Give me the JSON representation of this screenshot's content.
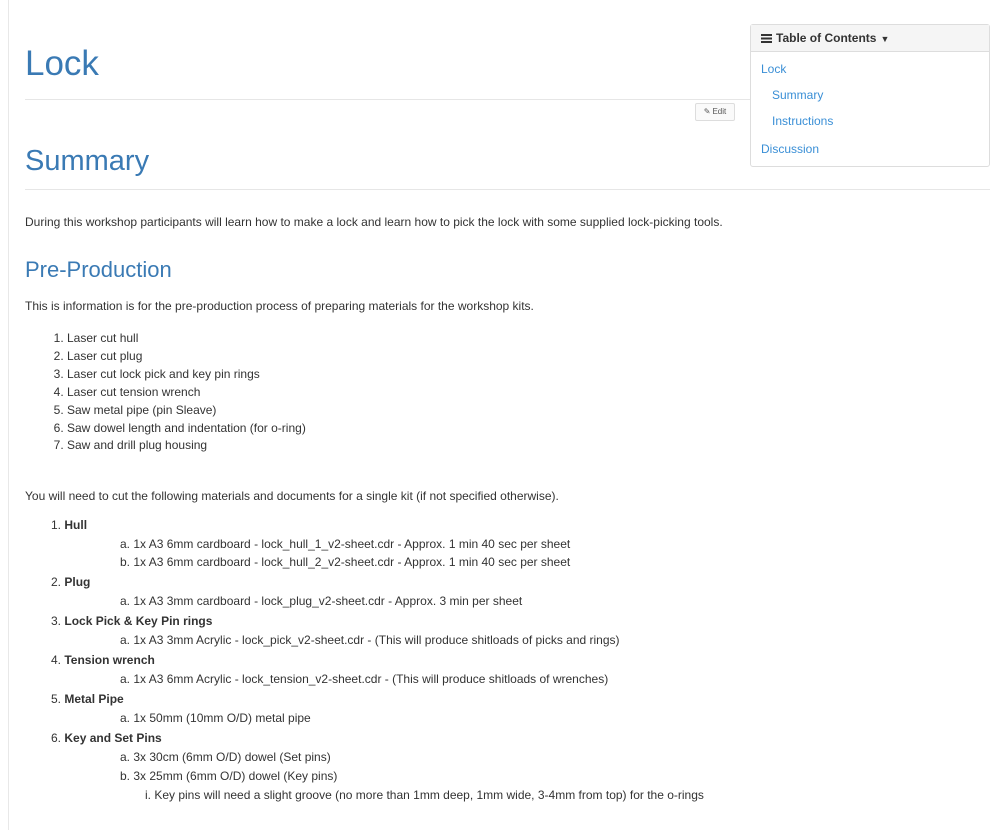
{
  "page": {
    "title": "Lock",
    "edit_label": "Edit",
    "summary_heading": "Summary",
    "summary_text": "During this workshop participants will learn how to make a lock and learn how to pick the lock with some supplied lock-picking tools.",
    "preproduction_heading": "Pre-Production",
    "preproduction_text": "This is information is for the pre-production process of preparing materials for the workshop kits.",
    "steps": [
      "Laser cut hull",
      "Laser cut plug",
      "Laser cut lock pick and key pin rings",
      "Laser cut tension wrench",
      "Saw metal pipe (pin Sleave)",
      "Saw dowel length and indentation (for o-ring)",
      "Saw and drill plug housing"
    ],
    "need_text": "You will need to cut the following materials and documents for a single kit (if not specified otherwise).",
    "materials": {
      "hull": {
        "num": "1.",
        "label": "Hull",
        "a": "a. 1x A3 6mm cardboard - lock_hull_1_v2-sheet.cdr - Approx. 1 min 40 sec per sheet",
        "b": "b. 1x A3 6mm cardboard - lock_hull_2_v2-sheet.cdr - Approx. 1 min 40 sec per sheet"
      },
      "plug": {
        "num": "2.",
        "label": "Plug",
        "a": "a. 1x A3 3mm cardboard - lock_plug_v2-sheet.cdr - Approx. 3 min per sheet"
      },
      "pick": {
        "num": "3.",
        "label": "Lock Pick & Key Pin rings",
        "a": "a. 1x A3 3mm Acrylic - lock_pick_v2-sheet.cdr - (This will produce shitloads of picks and rings)"
      },
      "tension": {
        "num": "4.",
        "label": "Tension wrench",
        "a": "a. 1x A3 6mm Acrylic - lock_tension_v2-sheet.cdr - (This will produce shitloads of wrenches)"
      },
      "pipe": {
        "num": "5.",
        "label": "Metal Pipe",
        "a": "a. 1x 50mm (10mm O/D) metal pipe"
      },
      "pins": {
        "num": "6.",
        "label": "Key and Set Pins",
        "a": "a. 3x 30cm (6mm O/D) dowel (Set pins)",
        "b": "b. 3x 25mm (6mm O/D) dowel (Key pins)",
        "i": "i. Key pins will need a slight groove (no more than 1mm deep, 1mm wide, 3-4mm from top) for the o-rings"
      }
    }
  },
  "toc": {
    "heading": "Table of Contents",
    "items": [
      "Lock",
      "Summary",
      "Instructions",
      "Discussion"
    ]
  },
  "colors": {
    "heading": "#3a7ab4",
    "link": "#3a8fd6",
    "text": "#333333"
  }
}
